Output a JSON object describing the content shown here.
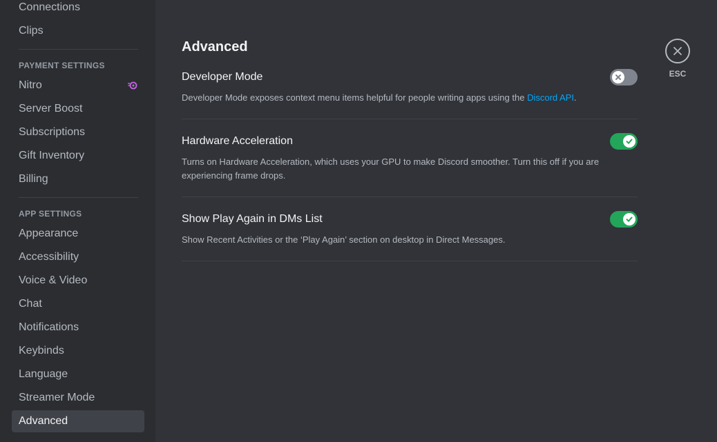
{
  "sidebar": {
    "top_items": [
      "Connections",
      "Clips"
    ],
    "payment_header": "PAYMENT SETTINGS",
    "payment_items": [
      "Nitro",
      "Server Boost",
      "Subscriptions",
      "Gift Inventory",
      "Billing"
    ],
    "app_header": "APP SETTINGS",
    "app_items": [
      "Appearance",
      "Accessibility",
      "Voice & Video",
      "Chat",
      "Notifications",
      "Keybinds",
      "Language",
      "Streamer Mode",
      "Advanced"
    ],
    "selected": "Advanced",
    "nitro_icon_color": "#c964e6"
  },
  "page": {
    "title": "Advanced"
  },
  "settings": [
    {
      "title": "Developer Mode",
      "desc_prefix": "Developer Mode exposes context menu items helpful for people writing apps using the ",
      "desc_link": "Discord API",
      "desc_suffix": ".",
      "enabled": false
    },
    {
      "title": "Hardware Acceleration",
      "desc": "Turns on Hardware Acceleration, which uses your GPU to make Discord smoother. Turn this off if you are experiencing frame drops.",
      "enabled": true
    },
    {
      "title": "Show Play Again in DMs List",
      "desc": "Show Recent Activities or the ‘Play Again’ section on desktop in Direct Messages.",
      "enabled": true
    }
  ],
  "close": {
    "label": "ESC"
  },
  "colors": {
    "toggle_on": "#23a55a",
    "toggle_off": "#80848e",
    "link": "#00a8fc"
  }
}
